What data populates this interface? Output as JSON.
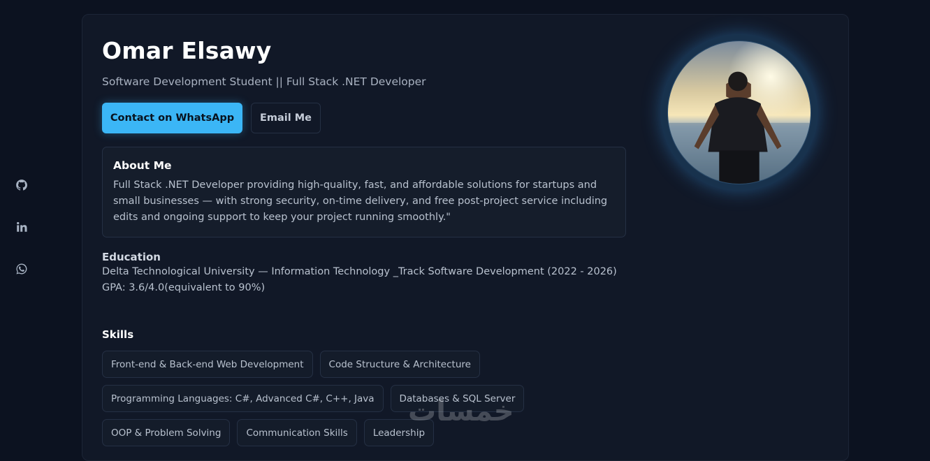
{
  "social": {
    "icons": [
      "github-icon",
      "linkedin-icon",
      "whatsapp-icon"
    ]
  },
  "profile": {
    "name": "Omar Elsawy",
    "subtitle": "Software Development Student || Full Stack .NET Developer",
    "whatsapp_label": "Contact on WhatsApp",
    "email_label": "Email Me",
    "accent_color": "#3bb6f6"
  },
  "about": {
    "title": "About Me",
    "text": "Full Stack .NET Developer providing high-quality, fast, and affordable solutions for startups and small businesses — with strong security, on-time delivery, and free post-project service including edits and ongoing support to keep your project running smoothly.\""
  },
  "education": {
    "title": "Education",
    "line1": "Delta Technological University — Information Technology _Track Software Development (2022 - 2026)",
    "line2": "GPA: 3.6/4.0(equivalent to 90%)"
  },
  "skills": {
    "title": "Skills",
    "items": [
      "Front-end & Back-end Web Development",
      "Code Structure & Architecture",
      "Programming Languages: C#, Advanced C#, C++, Java",
      "Databases & SQL Server",
      "OOP & Problem Solving",
      "Communication Skills",
      "Leadership"
    ]
  },
  "watermark": "خمسات"
}
